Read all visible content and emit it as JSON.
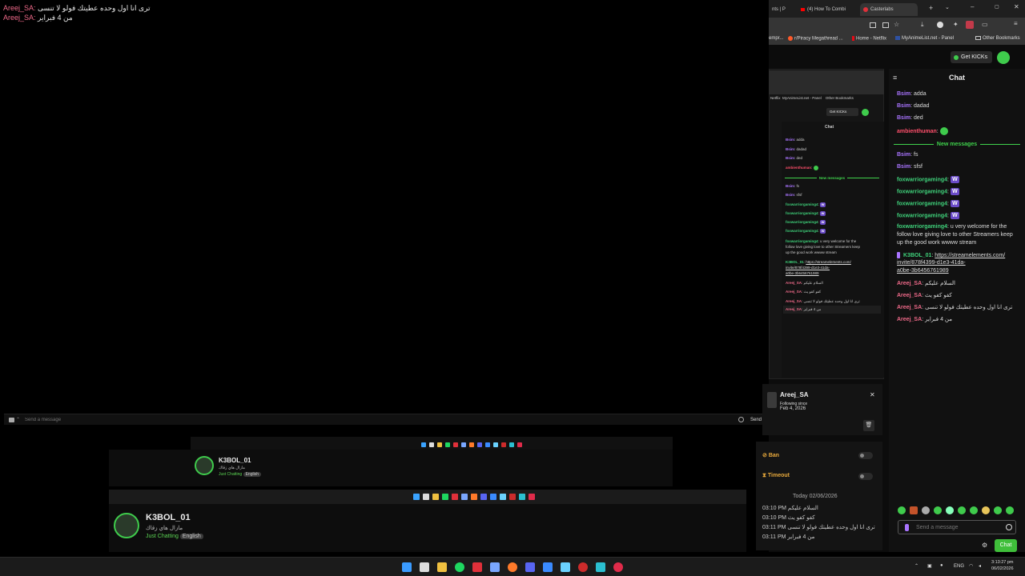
{
  "overlay": {
    "lines": [
      {
        "user": "Areej_SA:",
        "msg": "ترى انا اول وحده عطيتك فولو لا تنسى"
      },
      {
        "user": "Areej_SA:",
        "msg": "من 4 فبراير"
      }
    ]
  },
  "sendbar": {
    "placeholder": "Send a message",
    "send_label": "Send"
  },
  "stream_small": {
    "name": "K3BOL_01",
    "sub": "مازال هاي زقاك",
    "category": "Just Chatting",
    "language": "English"
  },
  "stream_large": {
    "name": "K3BOL_01",
    "sub": "مازال هاي زقاك",
    "category": "Just Chatting",
    "language": "English"
  },
  "browser": {
    "tabs": [
      {
        "label": "nts | P"
      },
      {
        "label": "(4) How To Combi"
      },
      {
        "label": "Casterlabs"
      }
    ],
    "bookmarks": [
      "empr...",
      "r/Piracy Megathread ...",
      "Home - Netflix",
      "MyAnimeList.net - Panel",
      "Other Bookmarks"
    ]
  },
  "page": {
    "get_kicks": "Get KICKs",
    "chat_title": "Chat",
    "new_messages": "New messages",
    "chat": [
      {
        "user": "Bsim",
        "cls": "u-purple",
        "msg": "adda"
      },
      {
        "user": "Bsim",
        "cls": "u-purple",
        "msg": "dadad"
      },
      {
        "user": "Bsim",
        "cls": "u-purple",
        "msg": "ded"
      },
      {
        "user": "ambienthuman",
        "cls": "u-red",
        "msg": ""
      },
      {
        "user": "Bsim",
        "cls": "u-purple",
        "msg": "fs"
      },
      {
        "user": "Bsim",
        "cls": "u-purple",
        "msg": "sfsf"
      },
      {
        "user": "foxwarriorgaming4",
        "cls": "u-green",
        "msg": ""
      },
      {
        "user": "foxwarriorgaming4",
        "cls": "u-green",
        "msg": ""
      },
      {
        "user": "foxwarriorgaming4",
        "cls": "u-green",
        "msg": ""
      },
      {
        "user": "foxwarriorgaming4",
        "cls": "u-green",
        "msg": ""
      },
      {
        "user": "foxwarriorgaming4",
        "cls": "u-green",
        "msg": "u very welcome for the"
      },
      {
        "user": "",
        "cls": "",
        "msg": "follow love giving love to other Streamers keep"
      },
      {
        "user": "",
        "cls": "",
        "msg": "up the good work wwww stream"
      },
      {
        "user": "K3BOL_01",
        "cls": "u-green",
        "msg": "https://streamelements.com/"
      },
      {
        "user": "",
        "cls": "",
        "msg": "invite/878f4399-d1e3-41da-"
      },
      {
        "user": "",
        "cls": "",
        "msg": "a0be-3b6456761989"
      },
      {
        "user": "Areej_SA",
        "cls": "u-pink",
        "msg": "السلام عليكم"
      },
      {
        "user": "Areej_SA",
        "cls": "u-pink",
        "msg": "كفو كفو يث"
      },
      {
        "user": "Areej_SA",
        "cls": "u-pink",
        "msg": "ترى انا اول وحده عطيتك فولو لا تنسى"
      },
      {
        "user": "Areej_SA",
        "cls": "u-pink",
        "msg": "من 4 فبراير"
      }
    ],
    "input_placeholder": "Send a message",
    "chat_button": "Chat"
  },
  "popup": {
    "username": "Areej_SA",
    "following_since": "Following since",
    "following_date": "Feb 4, 2026",
    "ban": "Ban",
    "timeout": "Timeout",
    "date_header": "Today 02/06/2026",
    "history": [
      {
        "time": "03:10 PM",
        "msg": "السلام عليكم"
      },
      {
        "time": "03:10 PM",
        "msg": "كفو كفو يث"
      },
      {
        "time": "03:11 PM",
        "msg": "ترى انا اول وحده عطيتك فولو لا تنسى"
      },
      {
        "time": "03:11 PM",
        "msg": "من 4 فبراير"
      }
    ]
  },
  "nested": {
    "chat_title": "Chat",
    "get_kicks": "Get KICKs",
    "new_messages": "New messages",
    "bm_netflix": "Netflix",
    "bm_mal": "MyAnimeList.net - Panel",
    "bm_other": "Other Bookmarks"
  },
  "taskbar": {
    "lang": "ENG",
    "time": "3:13:27 pm",
    "date": "06/02/2026"
  }
}
